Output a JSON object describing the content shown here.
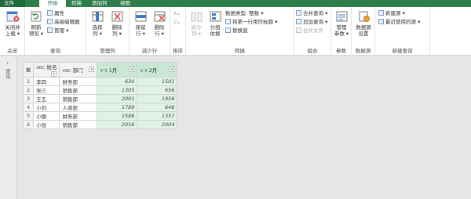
{
  "tabs": [
    "文件",
    "开始",
    "转换",
    "添加列",
    "视图"
  ],
  "ribbon": {
    "groups": {
      "close": "关闭",
      "query": "查询",
      "manage_cols": "管理列",
      "reduce_rows": "减少行",
      "sort": "排序",
      "transform": "转换",
      "combine": "组合",
      "params": "参数",
      "datasource": "数据源",
      "new_query": "新建查询"
    },
    "close_load": [
      "关闭并",
      "上载 ▾"
    ],
    "refresh_preview": [
      "刷新",
      "预览 ▾"
    ],
    "properties": "属性",
    "advanced_editor": "高级编辑器",
    "manage": "管理 ▾",
    "choose_cols": [
      "选择",
      "列 ▾"
    ],
    "remove_cols": [
      "删除",
      "列 ▾"
    ],
    "keep_rows": [
      "保留",
      "行 ▾"
    ],
    "remove_rows": [
      "删除",
      "行 ▾"
    ],
    "split_col": [
      "拆分",
      "列 ▾"
    ],
    "group_by": [
      "分组",
      "依据"
    ],
    "data_type": "数据类型: 整数 ▾",
    "first_row_header": "将第一行用作标题 ▾",
    "replace_values": "替换值",
    "merge_queries": "合并查询 ▾",
    "append_queries": "追加查询 ▾",
    "combine_files": "合并文件",
    "manage_params": [
      "管理",
      "参数 ▾"
    ],
    "ds_settings": [
      "数据源",
      "设置"
    ],
    "new_source": "新建源 ▾",
    "recent_sources": "最近使用的源 ▾"
  },
  "left_panel": "查询",
  "table": {
    "headers": [
      "姓名",
      "部门",
      "1月",
      "2月"
    ],
    "type_icons": [
      "ABC",
      "ABC",
      "1²3",
      "1²3"
    ],
    "rows": [
      [
        "1",
        "李四",
        "财务部",
        "630",
        "1501"
      ],
      [
        "2",
        "张三",
        "销售部",
        "1305",
        "656"
      ],
      [
        "3",
        "王五",
        "销售部",
        "2001",
        "1956"
      ],
      [
        "4",
        "小刘",
        "人资部",
        "1789",
        "648"
      ],
      [
        "5",
        "小丽",
        "财务部",
        "2586",
        "1357"
      ],
      [
        "6",
        "小张",
        "销售部",
        "2016",
        "2004"
      ]
    ]
  }
}
